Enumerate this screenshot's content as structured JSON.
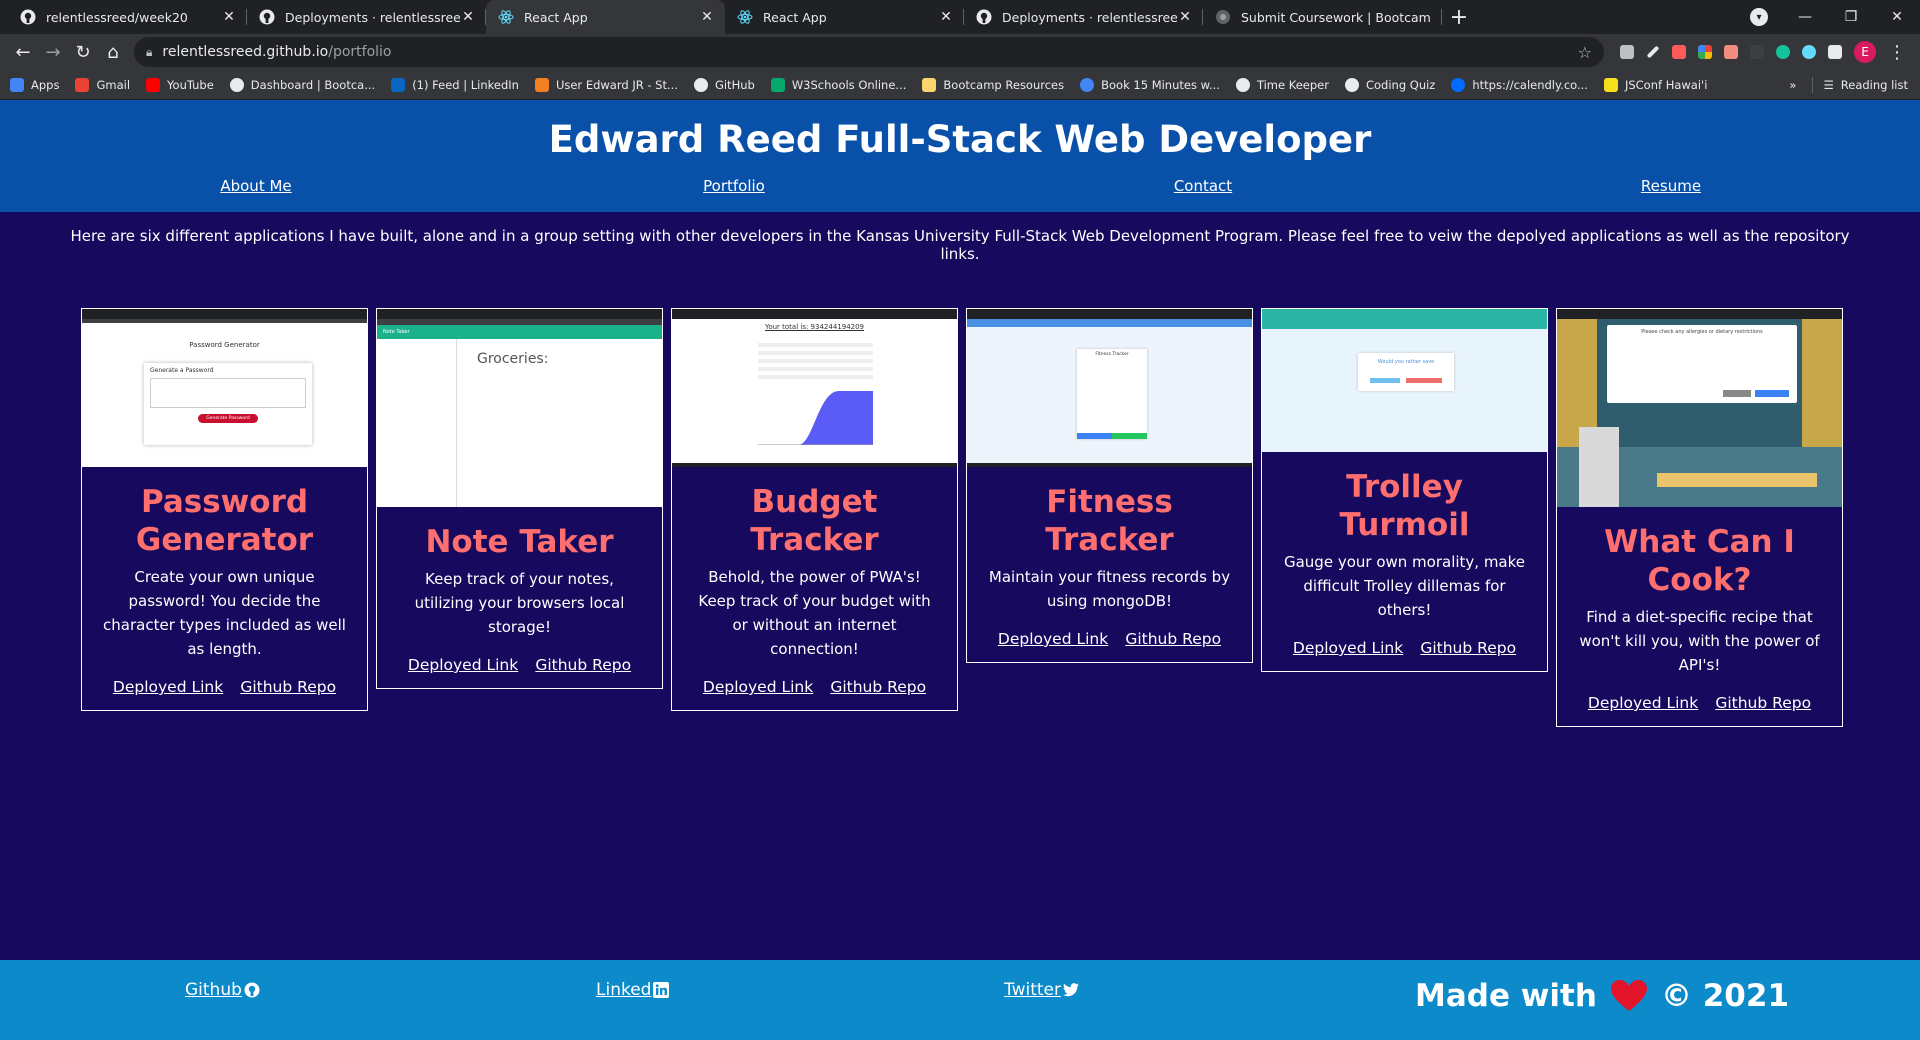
{
  "browser": {
    "tabs": [
      {
        "label": "relentlessreed/week20",
        "icon": "github-icon"
      },
      {
        "label": "Deployments · relentlessreed/we",
        "icon": "github-icon"
      },
      {
        "label": "React App",
        "icon": "react-icon",
        "active": true
      },
      {
        "label": "React App",
        "icon": "react-icon"
      },
      {
        "label": "Deployments · relentlessreed/we",
        "icon": "github-icon"
      },
      {
        "label": "Submit Coursework | Bootcamp S",
        "icon": "globe-icon"
      }
    ],
    "new_tab": "+",
    "url_host": "relentlessreed.github.io",
    "url_path": "/portfolio",
    "profile_initial": "E",
    "bookmarks": [
      {
        "label": "Apps",
        "color": "#4285f4"
      },
      {
        "label": "Gmail",
        "color": "#ea4335"
      },
      {
        "label": "YouTube",
        "color": "#ff0000"
      },
      {
        "label": "Dashboard | Bootca...",
        "color": "#e8eaed"
      },
      {
        "label": "(1) Feed | LinkedIn",
        "color": "#0a66c2"
      },
      {
        "label": "User Edward JR - St...",
        "color": "#f48024"
      },
      {
        "label": "GitHub",
        "color": "#e8eaed"
      },
      {
        "label": "W3Schools Online...",
        "color": "#04aa6d"
      },
      {
        "label": "Bootcamp Resources",
        "color": "#f9d56e"
      },
      {
        "label": "Book 15 Minutes w...",
        "color": "#4285f4"
      },
      {
        "label": "Time Keeper",
        "color": "#e8eaed"
      },
      {
        "label": "Coding Quiz",
        "color": "#e8eaed"
      },
      {
        "label": "https://calendly.co...",
        "color": "#006bff"
      },
      {
        "label": "JSConf Hawai'i",
        "color": "#f7df1e"
      }
    ],
    "more_bookmarks": "»",
    "reading_list": "Reading list"
  },
  "site": {
    "title": "Edward Reed Full-Stack Web Developer",
    "nav": [
      "About Me",
      "Portfolio",
      "Contact",
      "Resume"
    ],
    "intro": "Here are six different applications I have built, alone and in a group setting with other developers in the Kansas University Full-Stack Web Development Program. Please feel free to veiw the depolyed applications as well as the repository links.",
    "cards": [
      {
        "title": "Password Generator",
        "desc": "Create your own unique password! You decide the character types included as well as length.",
        "deployed": "Deployed Link",
        "repo": "Github Repo",
        "thumb": {
          "heading": "Password Generator",
          "sub": "Generate a Password",
          "button": "Generate Password"
        }
      },
      {
        "title": "Note Taker",
        "desc": "Keep track of your notes, utilizing your browsers local storage!",
        "deployed": "Deployed Link",
        "repo": "Github Repo",
        "thumb": {
          "heading": "Note Taker",
          "note": "Groceries:"
        }
      },
      {
        "title": "Budget Tracker",
        "desc": "Behold, the power of PWA's! Keep track of your budget with or without an internet connection!",
        "deployed": "Deployed Link",
        "repo": "Github Repo",
        "thumb": {
          "heading": "Your total is: 934244194209"
        }
      },
      {
        "title": "Fitness Tracker",
        "desc": "Maintain your fitness records by using mongoDB!",
        "deployed": "Deployed Link",
        "repo": "Github Repo",
        "thumb": {
          "heading": "Fitness Tracker"
        }
      },
      {
        "title": "Trolley Turmoil",
        "desc": "Gauge your own morality, make difficult Trolley dillemas for others!",
        "deployed": "Deployed Link",
        "repo": "Github Repo",
        "thumb": {
          "heading": "Would you rather save"
        }
      },
      {
        "title": "What Can I Cook?",
        "desc": "Find a diet-specific recipe that won't kill you, with the power of API's!",
        "deployed": "Deployed Link",
        "repo": "Github Repo",
        "thumb": {
          "heading": "Please check any allergies or dietary restrictions"
        }
      }
    ],
    "footer": {
      "github": "Github",
      "linkedin": "Linked",
      "twitter": "Twitter",
      "made_with": "Made with",
      "copyright": "© 2021"
    }
  }
}
